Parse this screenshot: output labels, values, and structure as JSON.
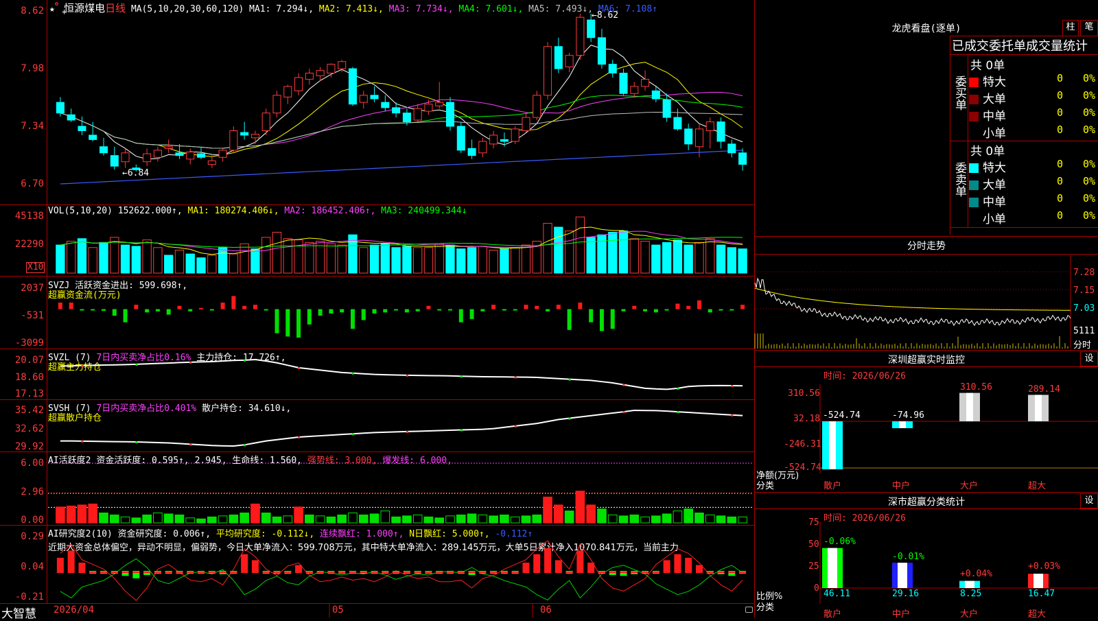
{
  "window": {
    "brand": "大智慧"
  },
  "stock": {
    "name": "恒源煤电",
    "period": "日线"
  },
  "kline": {
    "ma_header": "MA(5,10,20,30,60,120)",
    "ma1": "MA1: 7.294↓,",
    "ma2": "MA2: 7.413↓,",
    "ma3": "MA3: 7.734↓,",
    "ma4": "MA4: 7.601↓,",
    "ma5": "MA5: 7.493↓,",
    "ma6": "MA6: 7.108↑",
    "y_labels": [
      "8.62",
      "7.98",
      "7.34",
      "6.70"
    ],
    "high_label": "8.62",
    "low_label": "6.84"
  },
  "vol": {
    "header": "VOL(5,10,20)",
    "value": "152622.000↑,",
    "ma1": "MA1: 180274.406↓,",
    "ma2": "MA2: 186452.406↑,",
    "ma3": "MA3: 240499.344↓",
    "y_labels": [
      "45138",
      "22290"
    ],
    "unit": "X10"
  },
  "svzj": {
    "header": "SVZJ",
    "field": "活跃资金进出: 599.698↑,",
    "title": "超赢资金流(万元)",
    "y_labels": [
      "2037",
      "-531",
      "-3099"
    ]
  },
  "svzl": {
    "header": "SVZL (7)",
    "ratio": "7日内买卖净占比0.16%",
    "field": "主力持仓: 17.726↑,",
    "title": "超赢主力持仓",
    "y_labels": [
      "20.07",
      "18.60",
      "17.13"
    ]
  },
  "svsh": {
    "header": "SVSH (7)",
    "ratio": "7日内买卖净占比0.401%",
    "field": "散户持仓: 34.610↓,",
    "title": "超赢散户持仓",
    "y_labels": [
      "35.42",
      "32.62",
      "29.92"
    ]
  },
  "ai1": {
    "header": "AI活跃度2",
    "f1": "资金活跃度: 0.595↑,",
    "f2": "2.945,",
    "f3": "生命线: 1.560,",
    "f4": "强势线: 3.000,",
    "f5": "爆发线: 6.000,",
    "y_labels": [
      "6.00",
      "2.96",
      "0.00"
    ]
  },
  "ai2": {
    "header": "AI研究度2(10)",
    "f1": "资金研究度: 0.006↑,",
    "f2": "平均研究度: -0.112↓,",
    "f3": "连续飘红: 1.000↑,",
    "f4": "N日飘红: 5.000↑,",
    "f5": "-0.112↑",
    "commentary": "近期大资金总体偏空，异动不明显，偏弱势，今日大单净流入：599.708万元，其中特大单净流入：289.145万元，大单5日累计净入1070.841万元，当前主力",
    "y_labels": [
      "0.29",
      "0.04",
      "-0.21"
    ]
  },
  "xaxis": {
    "labels": [
      "2026/04",
      "05",
      "06"
    ]
  },
  "dragon": {
    "title": "龙虎看盘(逐单)",
    "btn1": "柱",
    "btn2": "笔",
    "tabs": "已成交委托单成交量统计",
    "buy_label": "委买单",
    "sell_label": "委卖单",
    "buy_total": "共 0单",
    "sell_total": "共 0单",
    "buy_rows": [
      {
        "name": "特大",
        "count": "0",
        "pct": "0%",
        "color": "#ff0000"
      },
      {
        "name": "大单",
        "count": "0",
        "pct": "0%",
        "color": "#8b0000"
      },
      {
        "name": "中单",
        "count": "0",
        "pct": "0%",
        "color": "#8b0000"
      },
      {
        "name": "小单",
        "count": "0",
        "pct": "0%",
        "color": ""
      }
    ],
    "sell_rows": [
      {
        "name": "特大",
        "count": "0",
        "pct": "0%",
        "color": "#00ffff"
      },
      {
        "name": "大单",
        "count": "0",
        "pct": "0%",
        "color": "#008b8b"
      },
      {
        "name": "中单",
        "count": "0",
        "pct": "0%",
        "color": "#008b8b"
      },
      {
        "name": "小单",
        "count": "0",
        "pct": "0%",
        "color": ""
      }
    ]
  },
  "intraday": {
    "title": "分时走势",
    "y_labels": [
      "7.28",
      "7.15",
      "7.03"
    ],
    "vol_label": "5111",
    "unit": "分时"
  },
  "monitor": {
    "title": "深圳超赢实时监控",
    "btn": "设",
    "time": "时间: 2026/06/26",
    "y_labels": [
      "310.56",
      "32.18",
      "-246.31",
      "-524.74"
    ],
    "left_label1": "净额(万元)",
    "left_label2": "分类",
    "categories": [
      "散户",
      "中户",
      "大户",
      "超大"
    ],
    "values": [
      -524.74,
      -74.96,
      310.56,
      289.14
    ],
    "value_labels": [
      "-524.74",
      "-74.96",
      "310.56",
      "289.14"
    ]
  },
  "classify": {
    "title": "深市超赢分类统计",
    "btn": "设",
    "time": "时间: 2026/06/26",
    "y_labels": [
      "75",
      "50",
      "25",
      "0"
    ],
    "left_label1": "比例%",
    "left_label2": "分类",
    "categories": [
      "散户",
      "中户",
      "大户",
      "超大"
    ],
    "values": [
      46.11,
      29.16,
      8.25,
      16.47
    ],
    "value_labels": [
      "46.11",
      "29.16",
      "8.25",
      "16.47"
    ],
    "change_labels": [
      "-0.06%",
      "-0.01%",
      "+0.04%",
      "+0.03%"
    ]
  },
  "chart_data": [
    {
      "type": "candlestick",
      "title": "恒源煤电 日线",
      "ylim": [
        6.7,
        8.62
      ],
      "ohlc": [
        [
          7.62,
          7.68,
          7.46,
          7.5
        ],
        [
          7.48,
          7.55,
          7.4,
          7.42
        ],
        [
          7.35,
          7.46,
          7.25,
          7.3
        ],
        [
          7.25,
          7.4,
          7.18,
          7.2
        ],
        [
          7.12,
          7.22,
          7.02,
          7.05
        ],
        [
          7.02,
          7.12,
          6.86,
          6.9
        ],
        [
          6.95,
          7.1,
          6.88,
          7.05
        ],
        [
          6.88,
          6.92,
          6.84,
          6.86
        ],
        [
          6.95,
          7.1,
          6.9,
          7.04
        ],
        [
          7.0,
          7.12,
          6.95,
          7.08
        ],
        [
          7.1,
          7.2,
          7.05,
          7.12
        ],
        [
          7.05,
          7.15,
          6.98,
          7.02
        ],
        [
          6.98,
          7.1,
          6.92,
          7.06
        ],
        [
          7.04,
          7.12,
          6.98,
          7.0
        ],
        [
          6.92,
          7.02,
          6.88,
          6.96
        ],
        [
          7.0,
          7.1,
          6.95,
          7.08
        ],
        [
          7.08,
          7.35,
          7.05,
          7.3
        ],
        [
          7.28,
          7.4,
          7.2,
          7.25
        ],
        [
          7.22,
          7.3,
          7.15,
          7.26
        ],
        [
          7.3,
          7.55,
          7.25,
          7.5
        ],
        [
          7.5,
          7.75,
          7.45,
          7.7
        ],
        [
          7.68,
          7.82,
          7.6,
          7.8
        ],
        [
          7.75,
          7.95,
          7.7,
          7.9
        ],
        [
          7.88,
          8.0,
          7.82,
          7.95
        ],
        [
          7.92,
          8.02,
          7.86,
          7.98
        ],
        [
          7.95,
          8.06,
          7.9,
          8.05
        ],
        [
          8.0,
          8.1,
          7.96,
          8.08
        ],
        [
          8.0,
          8.02,
          7.58,
          7.6
        ],
        [
          7.62,
          7.75,
          7.55,
          7.7
        ],
        [
          7.7,
          7.8,
          7.62,
          7.66
        ],
        [
          7.62,
          7.7,
          7.52,
          7.56
        ],
        [
          7.56,
          7.62,
          7.45,
          7.5
        ],
        [
          7.5,
          7.55,
          7.36,
          7.4
        ],
        [
          7.42,
          7.6,
          7.4,
          7.55
        ],
        [
          7.52,
          7.65,
          7.48,
          7.6
        ],
        [
          7.58,
          7.85,
          7.55,
          7.62
        ],
        [
          7.62,
          7.68,
          7.3,
          7.35
        ],
        [
          7.35,
          7.4,
          7.05,
          7.08
        ],
        [
          7.1,
          7.2,
          6.98,
          7.02
        ],
        [
          7.05,
          7.22,
          7.0,
          7.18
        ],
        [
          7.15,
          7.3,
          7.1,
          7.25
        ],
        [
          7.2,
          7.28,
          7.12,
          7.18
        ],
        [
          7.18,
          7.35,
          7.15,
          7.32
        ],
        [
          7.3,
          7.5,
          7.28,
          7.45
        ],
        [
          7.45,
          7.75,
          7.42,
          7.7
        ],
        [
          7.7,
          8.3,
          7.65,
          8.25
        ],
        [
          8.25,
          8.35,
          7.95,
          8.0
        ],
        [
          8.02,
          8.18,
          7.96,
          8.15
        ],
        [
          8.15,
          8.62,
          8.1,
          8.58
        ],
        [
          8.55,
          8.62,
          8.3,
          8.35
        ],
        [
          8.35,
          8.45,
          8.0,
          8.05
        ],
        [
          8.05,
          8.1,
          7.9,
          7.95
        ],
        [
          7.95,
          8.0,
          7.7,
          7.72
        ],
        [
          7.72,
          7.85,
          7.68,
          7.8
        ],
        [
          7.8,
          7.98,
          7.75,
          7.88
        ],
        [
          7.75,
          7.8,
          7.62,
          7.66
        ],
        [
          7.65,
          7.72,
          7.4,
          7.45
        ],
        [
          7.45,
          7.55,
          7.3,
          7.32
        ],
        [
          7.32,
          7.38,
          7.08,
          7.15
        ],
        [
          7.12,
          7.38,
          7.0,
          7.32
        ],
        [
          7.3,
          7.45,
          7.1,
          7.4
        ],
        [
          7.4,
          7.45,
          7.1,
          7.18
        ],
        [
          7.15,
          7.2,
          7.0,
          7.05
        ],
        [
          7.05,
          7.1,
          6.85,
          6.92
        ]
      ]
    },
    {
      "type": "bar",
      "title": "VOL(5,10,20)",
      "ylim": [
        0,
        45138
      ],
      "values": [
        22000,
        25000,
        27000,
        20000,
        24000,
        28000,
        22000,
        21000,
        26000,
        20000,
        14000,
        18000,
        15000,
        12000,
        14000,
        20000,
        15000,
        23000,
        19000,
        28000,
        32000,
        27000,
        26000,
        24000,
        25000,
        23000,
        22000,
        30000,
        20000,
        22000,
        23000,
        20000,
        21000,
        20000,
        20000,
        23000,
        22000,
        19000,
        20000,
        21000,
        18000,
        19000,
        20000,
        22000,
        25000,
        39000,
        36000,
        33000,
        44000,
        28000,
        30000,
        32000,
        33000,
        27000,
        25000,
        22000,
        24000,
        26000,
        22000,
        24000,
        27000,
        22000,
        20000,
        19000
      ],
      "colors": [
        "c",
        "r",
        "c",
        "r",
        "c",
        "r",
        "c",
        "c",
        "r",
        "r",
        "c",
        "r",
        "c",
        "c",
        "r",
        "c",
        "r",
        "r",
        "c",
        "r",
        "r",
        "r",
        "r",
        "r",
        "r",
        "r",
        "r",
        "c",
        "r",
        "c",
        "c",
        "c",
        "c",
        "r",
        "r",
        "r",
        "c",
        "c",
        "c",
        "r",
        "r",
        "c",
        "r",
        "r",
        "r",
        "r",
        "c",
        "r",
        "r",
        "c",
        "c",
        "c",
        "c",
        "r",
        "r",
        "c",
        "c",
        "c",
        "c",
        "r",
        "r",
        "c",
        "c",
        "c"
      ]
    },
    {
      "type": "bar",
      "title": "SVZJ 活跃资金进出",
      "ylim": [
        -3099,
        2037
      ],
      "values": [
        600,
        600,
        -100,
        -100,
        -150,
        -600,
        -1200,
        400,
        -300,
        -200,
        -500,
        300,
        -200,
        100,
        -100,
        600,
        1200,
        300,
        400,
        -100,
        -2200,
        -2500,
        -2600,
        -1400,
        -600,
        -400,
        -300,
        -1800,
        -1000,
        -400,
        -300,
        -100,
        -300,
        -200,
        300,
        -100,
        -100,
        -1200,
        -900,
        -200,
        400,
        -100,
        -100,
        400,
        300,
        -200,
        400,
        -1900,
        600,
        -1200,
        -2000,
        -1800,
        -200,
        300,
        -200,
        -300,
        -100,
        500,
        300,
        800,
        -300,
        -100,
        -100,
        400
      ],
      "colors": []
    },
    {
      "type": "line",
      "title": "超赢主力持仓",
      "ylim": [
        17.13,
        20.07
      ],
      "values": [
        19.55,
        19.55,
        19.58,
        19.6,
        19.62,
        19.63,
        19.65,
        19.68,
        19.72,
        19.75,
        19.78,
        19.82,
        19.85,
        19.88,
        19.9,
        19.95,
        20.0,
        20.02,
        20.07,
        19.95,
        19.8,
        19.6,
        19.4,
        19.3,
        19.2,
        19.1,
        19.0,
        18.95,
        18.9,
        18.85,
        18.82,
        18.8,
        18.78,
        18.76,
        18.75,
        18.74,
        18.73,
        18.7,
        18.68,
        18.66,
        18.65,
        18.64,
        18.63,
        18.62,
        18.6,
        18.55,
        18.5,
        18.45,
        18.4,
        18.35,
        18.25,
        18.15,
        18.0,
        17.85,
        17.7,
        17.65,
        17.62,
        17.7,
        17.85,
        17.9,
        17.92,
        17.93,
        17.92,
        17.91
      ]
    },
    {
      "type": "line",
      "title": "超赢散户持仓",
      "ylim": [
        29.92,
        35.42
      ],
      "values": [
        30.7,
        30.7,
        30.68,
        30.65,
        30.62,
        30.6,
        30.58,
        30.55,
        30.5,
        30.45,
        30.4,
        30.3,
        30.2,
        30.1,
        30.0,
        29.95,
        29.92,
        30.1,
        30.4,
        30.7,
        30.9,
        31.1,
        31.3,
        31.4,
        31.5,
        31.6,
        31.7,
        31.8,
        31.9,
        32.0,
        32.05,
        32.1,
        32.15,
        32.2,
        32.25,
        32.3,
        32.35,
        32.4,
        32.45,
        32.5,
        32.6,
        32.8,
        33.0,
        33.2,
        33.4,
        33.7,
        34.0,
        34.2,
        34.4,
        34.6,
        34.8,
        35.0,
        35.2,
        35.42,
        35.4,
        35.38,
        35.3,
        35.2,
        35.1,
        35.0,
        34.9,
        34.8,
        34.7,
        34.61
      ]
    },
    {
      "type": "bar",
      "title": "AI活跃度2",
      "ylim": [
        0,
        6.0
      ],
      "values": [
        1.6,
        1.7,
        1.8,
        1.9,
        1.0,
        0.8,
        0.6,
        0.5,
        0.8,
        1.0,
        0.9,
        0.8,
        0.5,
        0.4,
        0.6,
        0.7,
        0.8,
        1.0,
        1.9,
        1.0,
        0.6,
        0.7,
        1.6,
        0.8,
        0.7,
        0.6,
        0.8,
        1.0,
        0.8,
        0.9,
        1.2,
        0.6,
        0.7,
        0.8,
        0.6,
        0.5,
        0.7,
        0.8,
        0.9,
        0.8,
        0.7,
        0.8,
        0.6,
        0.7,
        0.8,
        2.6,
        1.8,
        1.2,
        3.2,
        1.8,
        1.4,
        0.8,
        0.7,
        0.8,
        0.6,
        0.7,
        0.9,
        1.2,
        1.4,
        1.0,
        0.8,
        0.7,
        0.6,
        0.6
      ]
    }
  ]
}
